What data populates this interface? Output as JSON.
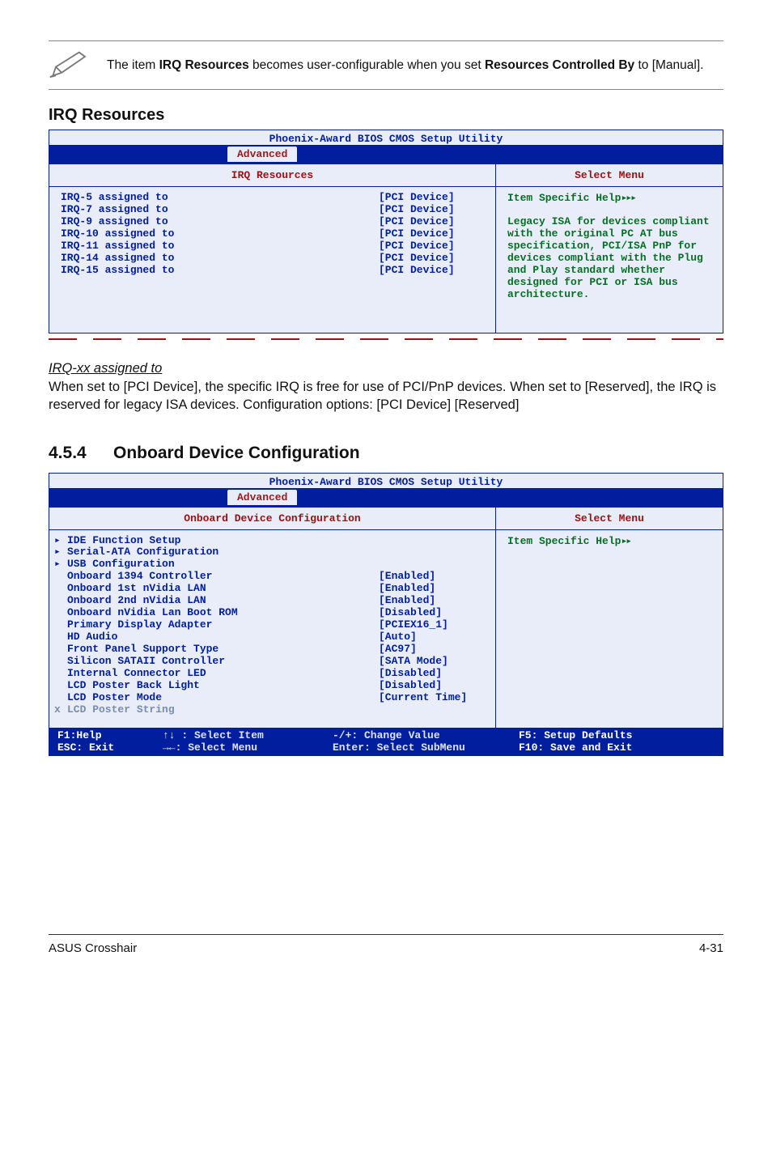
{
  "note": {
    "line1_pre": "The item ",
    "line1_bold1": "IRQ Resources",
    "line1_mid": " becomes user-configurable when you set ",
    "line1_bold2": "Resources Controlled By",
    "line1_post": " to [Manual]."
  },
  "irq_section_title": "IRQ Resources",
  "bios1": {
    "title": "Phoenix-Award BIOS CMOS Setup Utility",
    "tab": "Advanced",
    "left_title": "IRQ Resources",
    "right_title": "Select Menu",
    "items": [
      {
        "label": "IRQ-5 assigned to",
        "value": "[PCI Device]"
      },
      {
        "label": "IRQ-7 assigned to",
        "value": "[PCI Device]"
      },
      {
        "label": "IRQ-9 assigned to",
        "value": "[PCI Device]"
      },
      {
        "label": "IRQ-10 assigned to",
        "value": "[PCI Device]"
      },
      {
        "label": "IRQ-11 assigned to",
        "value": "[PCI Device]"
      },
      {
        "label": "IRQ-14 assigned to",
        "value": "[PCI Device]"
      },
      {
        "label": "IRQ-15 assigned to",
        "value": "[PCI Device]"
      }
    ],
    "help_head": "Item Specific Help",
    "help_body": "Legacy ISA for devices compliant with the original PC AT bus specification, PCI/ISA PnP for devices compliant with the Plug and Play standard whether designed for PCI or ISA bus architecture."
  },
  "irq_assigned": {
    "heading": "IRQ-xx assigned to",
    "p1": "When set to [PCI Device], the specific IRQ is free for use of PCI/PnP devices. When set to [Reserved], the IRQ is reserved for legacy ISA devices. Configuration options: [PCI Device] [Reserved]"
  },
  "section_454": {
    "num": "4.5.4",
    "title": "Onboard Device Configuration"
  },
  "bios2": {
    "title": "Phoenix-Award BIOS CMOS Setup Utility",
    "tab": "Advanced",
    "left_title": "Onboard Device Configuration",
    "right_title": "Select Menu",
    "items": [
      {
        "marker": "▸",
        "label": "IDE Function Setup",
        "value": ""
      },
      {
        "marker": "▸",
        "label": "Serial-ATA Configuration",
        "value": ""
      },
      {
        "marker": "▸",
        "label": "USB Configuration",
        "value": ""
      },
      {
        "marker": "",
        "label": "Onboard 1394 Controller",
        "value": "[Enabled]"
      },
      {
        "marker": "",
        "label": "Onboard 1st nVidia LAN",
        "value": "[Enabled]"
      },
      {
        "marker": "",
        "label": "Onboard 2nd nVidia LAN",
        "value": "[Enabled]"
      },
      {
        "marker": "",
        "label": "Onboard nVidia Lan Boot ROM",
        "value": "[Disabled]"
      },
      {
        "marker": "",
        "label": "Primary Display Adapter",
        "value": "[PCIEX16_1]"
      },
      {
        "marker": "",
        "label": "HD Audio",
        "value": "[Auto]"
      },
      {
        "marker": "",
        "label": "Front Panel Support Type",
        "value": "[AC97]"
      },
      {
        "marker": "",
        "label": "Silicon SATAII Controller",
        "value": "[SATA Mode]"
      },
      {
        "marker": "",
        "label": "Internal Connector LED",
        "value": "[Disabled]"
      },
      {
        "marker": "",
        "label": "LCD Poster Back Light",
        "value": "[Disabled]"
      },
      {
        "marker": "",
        "label": "LCD Poster Mode",
        "value": "[Current Time]"
      },
      {
        "marker": "x",
        "label": "LCD Poster String",
        "value": "",
        "disabled": true
      }
    ],
    "help_head": "Item Specific Help",
    "footer": {
      "c1a": "F1:Help",
      "c1b": "ESC: Exit",
      "c2a": "↑↓ : Select Item",
      "c2b": "→←: Select Menu",
      "c3a": "-/+: Change Value",
      "c3b": "Enter: Select SubMenu",
      "c4a": "F5: Setup Defaults",
      "c4b": "F10: Save and Exit"
    }
  },
  "footer_left": "ASUS Crosshair",
  "footer_right": "4-31"
}
